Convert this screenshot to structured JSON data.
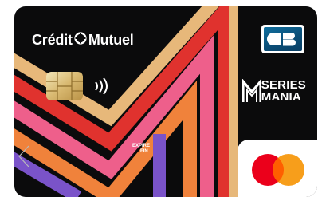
{
  "card": {
    "bank_name": "Crédit Mutuel",
    "bank_name_left": "Crédit",
    "bank_name_right": "Mutuel",
    "network_badge": "CB",
    "partner_line1": "SERIES",
    "partner_line2": "MANIA",
    "expiry_line1": "EXPIRE",
    "expiry_line2": "FIN",
    "icons": [
      "chip-icon",
      "contactless-icon",
      "series-mania-logo",
      "mastercard-logo",
      "cb-logo"
    ],
    "colors": {
      "background": "#0b0b0c",
      "stripe_orange": "#f0823b",
      "stripe_red": "#e0322e",
      "stripe_pink": "#ee5f8b",
      "stripe_purple": "#7a53c9",
      "stripe_gold": "#e7b87a",
      "mastercard_red": "#eb001b",
      "mastercard_yellow": "#f79e1b"
    }
  }
}
